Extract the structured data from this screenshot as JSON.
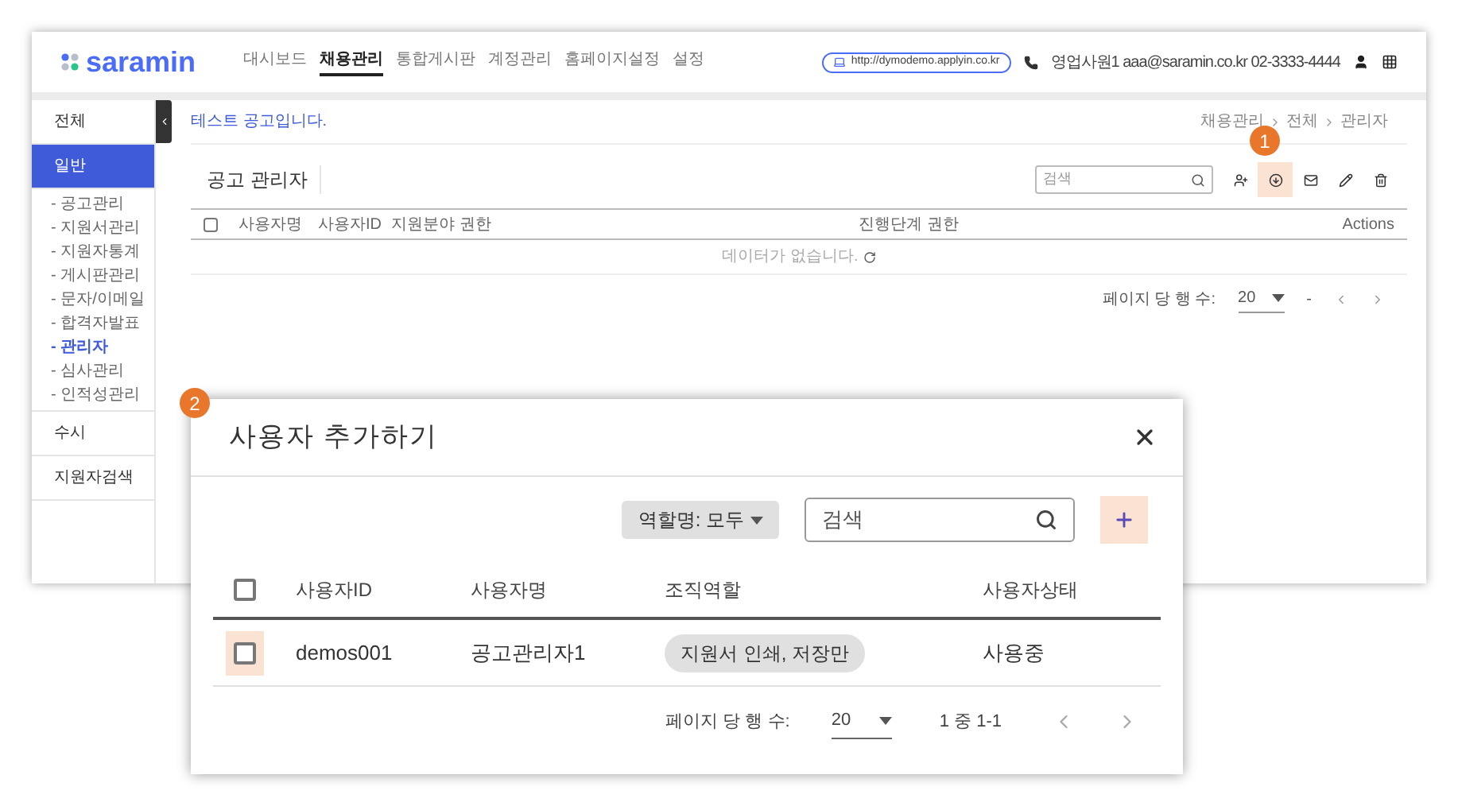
{
  "app": {
    "logo": "saramin",
    "nav": [
      {
        "label": "대시보드",
        "selected": false
      },
      {
        "label": "채용관리",
        "selected": true
      },
      {
        "label": "통합게시판",
        "selected": false
      },
      {
        "label": "계정관리",
        "selected": false
      },
      {
        "label": "홈페이지설정",
        "selected": false
      },
      {
        "label": "설정",
        "selected": false
      }
    ],
    "url": "http://dymodemo.applyin.co.kr",
    "contact": "영업사원1 aaa@saramin.co.kr 02-3333-4444"
  },
  "sidebar": {
    "items": [
      {
        "label": "전체",
        "selected": false
      },
      {
        "label": "일반",
        "selected": true,
        "children": [
          {
            "label": "- 공고관리",
            "selected": false
          },
          {
            "label": "- 지원서관리",
            "selected": false
          },
          {
            "label": "- 지원자통계",
            "selected": false
          },
          {
            "label": "- 게시판관리",
            "selected": false
          },
          {
            "label": "- 문자/이메일",
            "selected": false
          },
          {
            "label": "- 합격자발표",
            "selected": false
          },
          {
            "label": "- 관리자",
            "selected": true
          },
          {
            "label": "- 심사관리",
            "selected": false
          },
          {
            "label": "- 인적성관리",
            "selected": false
          }
        ]
      },
      {
        "label": "수시",
        "selected": false
      },
      {
        "label": "지원자검색",
        "selected": false
      }
    ]
  },
  "notice": "테스트 공고입니다.",
  "breadcrumb": [
    "채용관리",
    "전체",
    "관리자"
  ],
  "panel": {
    "title": "공고 관리자",
    "search": {
      "placeholder": "검색"
    },
    "toolbar": [
      {
        "kind": "add-user",
        "highlighted": false
      },
      {
        "kind": "download",
        "highlighted": true
      },
      {
        "kind": "mail",
        "highlighted": false
      },
      {
        "kind": "edit",
        "highlighted": false
      },
      {
        "kind": "delete",
        "highlighted": false
      }
    ],
    "table": {
      "select_all": {
        "checked": false
      },
      "columns": [
        "사용자명",
        "사용자ID",
        "지원분야 권한",
        "진행단계 권한",
        "Actions"
      ],
      "empty_text": "데이터가 없습니다."
    },
    "pagination": {
      "rows_label": "페이지 당 행 수:",
      "rows_value": "20",
      "range": "-"
    }
  },
  "badges": [
    {
      "label": "1"
    },
    {
      "label": "2"
    }
  ],
  "dialog": {
    "title": "사용자 추가하기",
    "role_filter": "역할명: 모두",
    "search": {
      "placeholder": "검색"
    },
    "add_highlighted": true,
    "table": {
      "select_all": {
        "checked": false
      },
      "columns": [
        "사용자ID",
        "사용자명",
        "조직역할",
        "사용자상태"
      ],
      "rows": [
        {
          "checked": false,
          "highlighted": true,
          "user_id": "demos001",
          "user_name": "공고관리자1",
          "role": "지원서 인쇄, 저장만",
          "status": "사용중"
        }
      ]
    },
    "pagination": {
      "rows_label": "페이지 당 행 수:",
      "rows_value": "20",
      "range": "1 중 1-1"
    }
  }
}
